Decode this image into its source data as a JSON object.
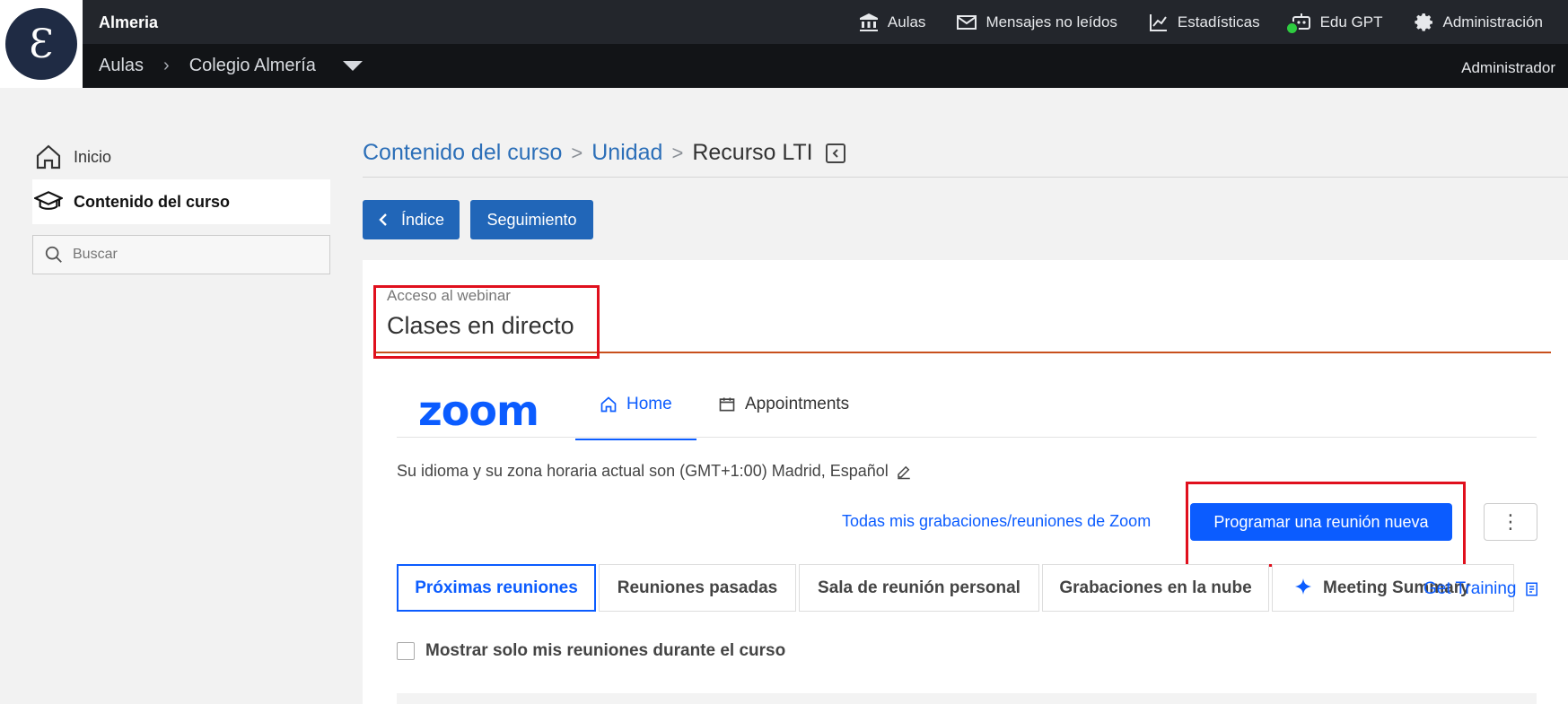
{
  "header": {
    "site_name": "Almeria",
    "breadcrumb": [
      "Aulas",
      "Colegio Almería"
    ],
    "nav": [
      {
        "label": "Aulas",
        "icon": "bank-icon"
      },
      {
        "label": "Mensajes no leídos",
        "icon": "envelope-icon"
      },
      {
        "label": "Estadísticas",
        "icon": "chart-line-icon"
      },
      {
        "label": "Edu GPT",
        "icon": "robot-icon"
      },
      {
        "label": "Administración",
        "icon": "gear-icon"
      }
    ],
    "user": "Administrador"
  },
  "sidebar": {
    "items": [
      {
        "label": "Inicio",
        "icon": "home-icon"
      },
      {
        "label": "Contenido del curso",
        "icon": "graduation-cap-icon",
        "active": true
      }
    ],
    "search_placeholder": "Buscar"
  },
  "main": {
    "breadcrumb": {
      "root": "Contenido del curso",
      "parent": "Unidad",
      "current": "Recurso LTI"
    },
    "buttons": {
      "index": "Índice",
      "tracking": "Seguimiento"
    },
    "card": {
      "sub_label": "Acceso al webinar",
      "title": "Clases en directo"
    }
  },
  "zoom": {
    "logo": "zoom",
    "tabs": {
      "home": "Home",
      "appointments": "Appointments"
    },
    "timezone_text": "Su idioma y su zona horaria actual son (GMT+1:00) Madrid, Español",
    "recordings_link": "Todas mis grabaciones/reuniones de Zoom",
    "schedule_button": "Programar una reunión nueva",
    "more_button": "⋮",
    "meeting_tabs": [
      "Próximas reuniones",
      "Reuniones pasadas",
      "Sala de reunión personal",
      "Grabaciones en la nube",
      "Meeting Summary"
    ],
    "get_training": "Get Training",
    "checkbox_label": "Mostrar solo mis reuniones durante el curso"
  },
  "colors": {
    "accent_zoom": "#0b5cff",
    "accent_lms": "#2166b8",
    "highlight": "#e0101d"
  }
}
